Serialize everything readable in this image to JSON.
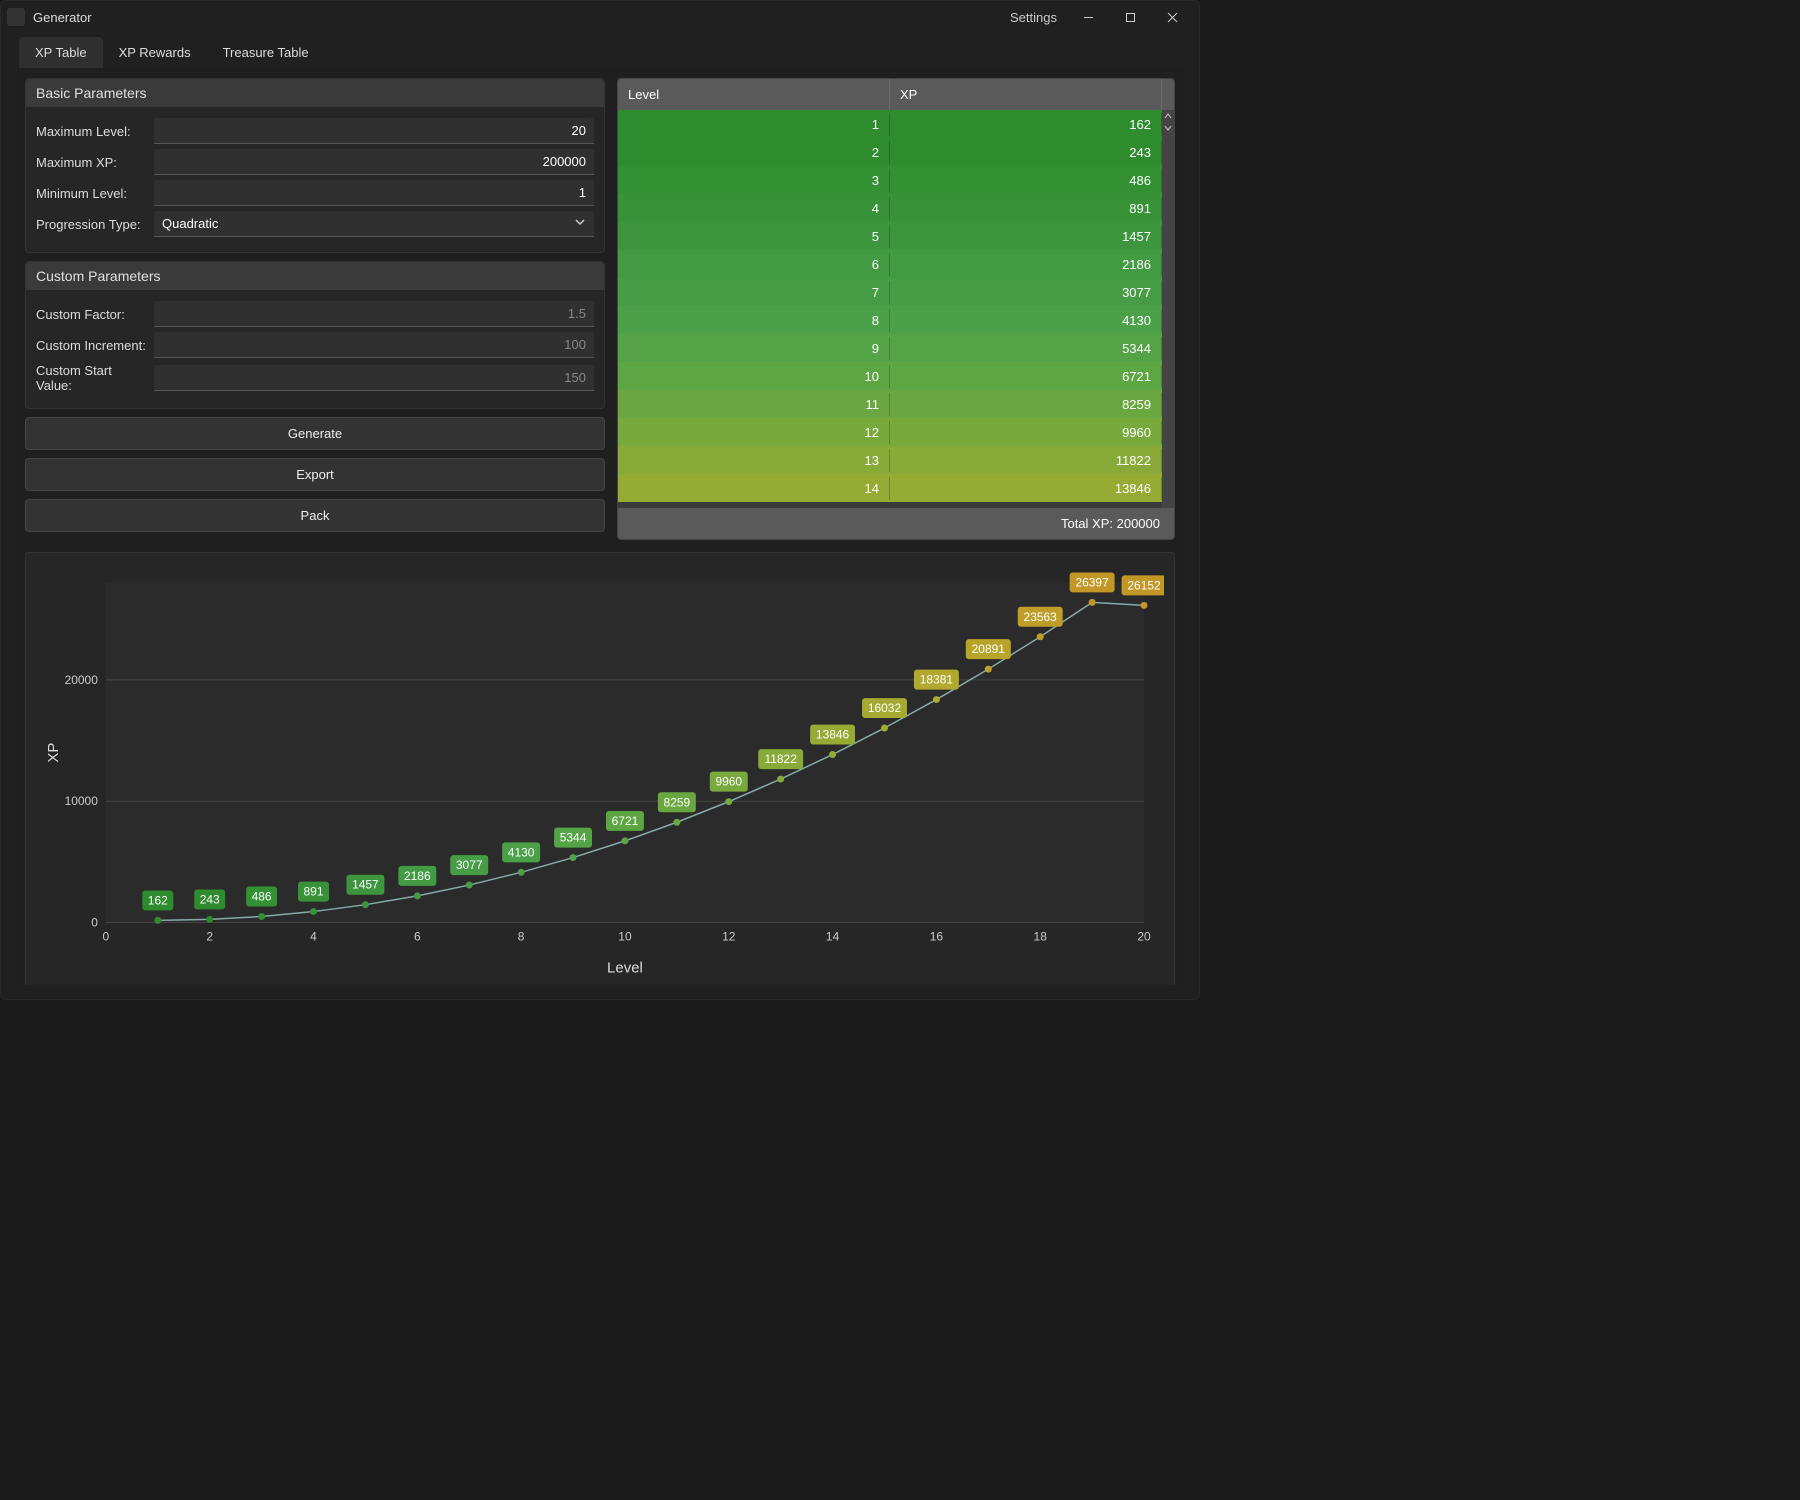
{
  "window": {
    "title": "Generator",
    "settings": "Settings"
  },
  "tabs": [
    {
      "label": "XP Table",
      "active": true
    },
    {
      "label": "XP Rewards",
      "active": false
    },
    {
      "label": "Treasure Table",
      "active": false
    }
  ],
  "basic": {
    "header": "Basic Parameters",
    "max_level_label": "Maximum Level:",
    "max_level_value": "20",
    "max_xp_label": "Maximum XP:",
    "max_xp_value": "200000",
    "min_level_label": "Minimum Level:",
    "min_level_value": "1",
    "progression_label": "Progression Type:",
    "progression_value": "Quadratic"
  },
  "custom": {
    "header": "Custom Parameters",
    "factor_label": "Custom Factor:",
    "factor_placeholder": "1.5",
    "increment_label": "Custom Increment:",
    "increment_placeholder": "100",
    "start_label": "Custom Start Value:",
    "start_placeholder": "150"
  },
  "buttons": {
    "generate": "Generate",
    "export": "Export",
    "pack": "Pack"
  },
  "table": {
    "col_level": "Level",
    "col_xp": "XP",
    "rows": [
      {
        "level": 1,
        "xp": 162,
        "color": "#2e8b2e"
      },
      {
        "level": 2,
        "xp": 243,
        "color": "#2e8b2e"
      },
      {
        "level": 3,
        "xp": 486,
        "color": "#339033"
      },
      {
        "level": 4,
        "xp": 891,
        "color": "#389338"
      },
      {
        "level": 5,
        "xp": 1457,
        "color": "#3d963d"
      },
      {
        "level": 6,
        "xp": 2186,
        "color": "#429a42"
      },
      {
        "level": 7,
        "xp": 3077,
        "color": "#479d46"
      },
      {
        "level": 8,
        "xp": 4130,
        "color": "#4ca048"
      },
      {
        "level": 9,
        "xp": 5344,
        "color": "#54a347"
      },
      {
        "level": 10,
        "xp": 6721,
        "color": "#5ea544"
      },
      {
        "level": 11,
        "xp": 8259,
        "color": "#6aa740"
      },
      {
        "level": 12,
        "xp": 9960,
        "color": "#78a93c"
      },
      {
        "level": 13,
        "xp": 11822,
        "color": "#87aa38"
      },
      {
        "level": 14,
        "xp": 13846,
        "color": "#96ab34"
      }
    ],
    "total_label": "Total XP: 200000"
  },
  "chart_data": {
    "type": "line",
    "title": "",
    "xlabel": "Level",
    "ylabel": "XP",
    "x": [
      1,
      2,
      3,
      4,
      5,
      6,
      7,
      8,
      9,
      10,
      11,
      12,
      13,
      14,
      15,
      16,
      17,
      18,
      19,
      20
    ],
    "values": [
      162,
      243,
      486,
      891,
      1457,
      2186,
      3077,
      4130,
      5344,
      6721,
      8259,
      9960,
      11822,
      13846,
      16032,
      18381,
      20891,
      23563,
      26397,
      26152
    ],
    "xlim": [
      0,
      20
    ],
    "ylim": [
      0,
      28000
    ],
    "xticks": [
      0,
      2,
      4,
      6,
      8,
      10,
      12,
      14,
      16,
      18,
      20
    ],
    "yticks": [
      0,
      10000,
      20000
    ],
    "point_colors": [
      "#2e8b2e",
      "#2e8b2e",
      "#339033",
      "#389338",
      "#3d963d",
      "#429a42",
      "#479d46",
      "#4ca048",
      "#54a347",
      "#5ea544",
      "#6aa740",
      "#78a93c",
      "#87aa38",
      "#96ab34",
      "#a5ab30",
      "#b1a92d",
      "#b9a42a",
      "#bf9e28",
      "#c39726",
      "#c39726"
    ]
  }
}
